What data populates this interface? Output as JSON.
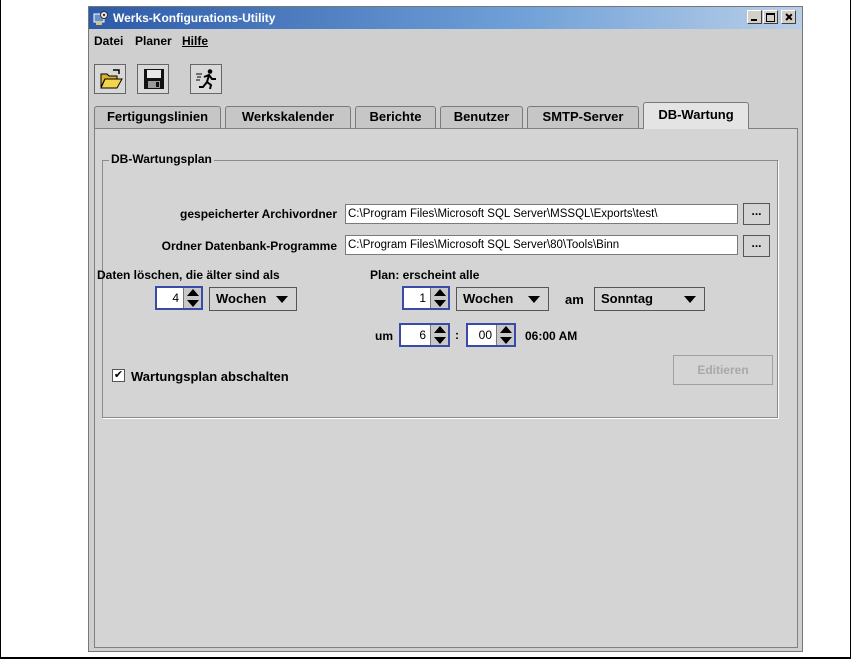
{
  "window": {
    "title": "Werks-Konfigurations-Utility"
  },
  "menu": {
    "items": [
      {
        "label": "Datei"
      },
      {
        "label": "Planer"
      },
      {
        "label": "Hilfe"
      }
    ]
  },
  "toolbar": {
    "buttons": [
      {
        "icon": "open-folder-icon"
      },
      {
        "icon": "save-disk-icon"
      },
      {
        "icon": "exit-running-man-icon"
      }
    ]
  },
  "tabs": [
    {
      "label": "Fertigungslinien"
    },
    {
      "label": "Werkskalender"
    },
    {
      "label": "Berichte"
    },
    {
      "label": "Benutzer"
    },
    {
      "label": "SMTP-Server"
    },
    {
      "label": "DB-Wartung",
      "active": true
    }
  ],
  "panel": {
    "group_title": "DB-Wartungsplan",
    "archive_label": "gespeicherter Archivordner",
    "archive_value": "C:\\Program Files\\Microsoft SQL Server\\MSSQL\\Exports\\test\\",
    "programs_label": "Ordner Datenbank-Programme",
    "programs_value": "C:\\Program Files\\Microsoft SQL Server\\80\\Tools\\Binn",
    "browse_label": "...",
    "delete_label": "Daten löschen, die älter sind als",
    "delete_value": "4",
    "delete_unit": "Wochen",
    "plan_label": "Plan: erscheint alle",
    "plan_value": "1",
    "plan_unit": "Wochen",
    "am_label": "am",
    "weekday": "Sonntag",
    "um_label": "um",
    "hour": "6",
    "colon": ":",
    "minute": "00",
    "time_display": "06:00 AM",
    "disable_label": "Wartungsplan abschalten",
    "disable_checked": true,
    "check_mark": "✔",
    "edit_label": "Editieren"
  }
}
